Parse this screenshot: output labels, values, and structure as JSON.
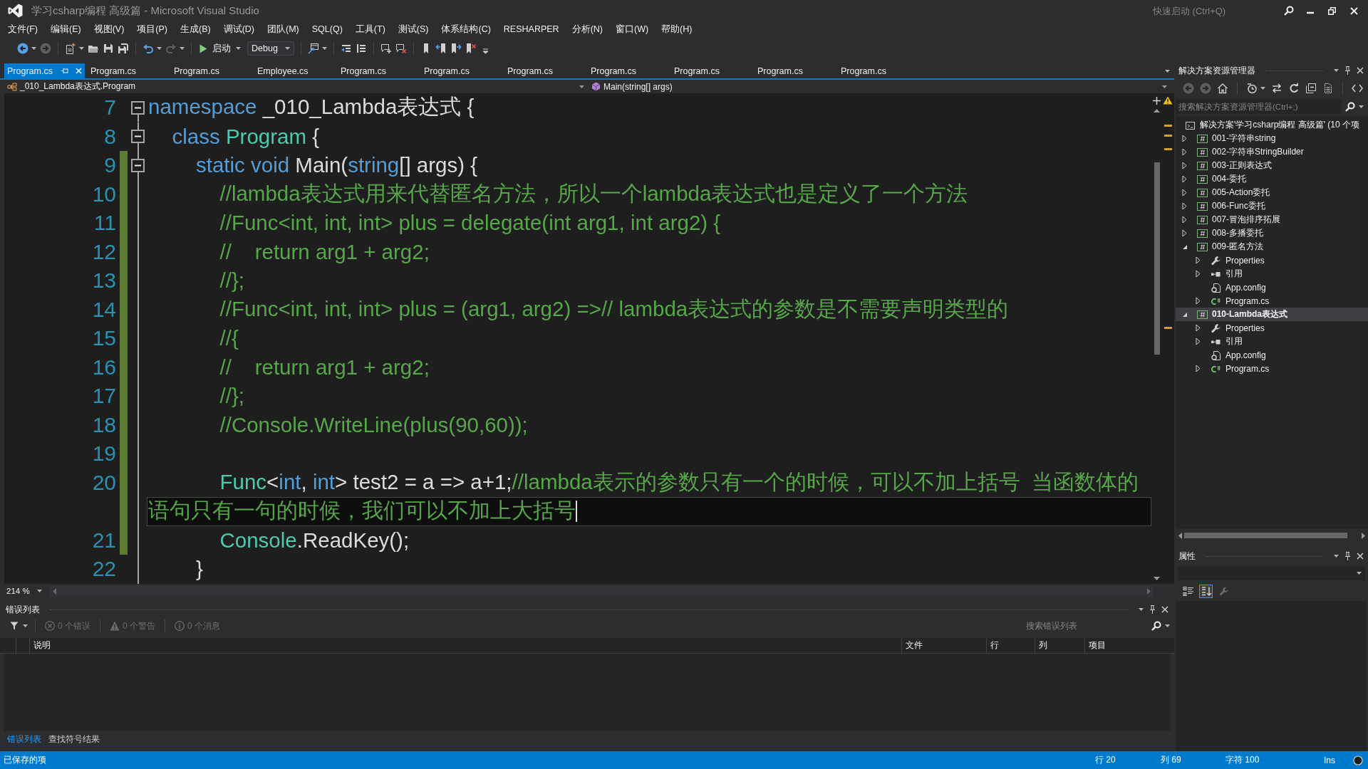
{
  "window": {
    "title": "学习csharp编程 高级篇 - Microsoft Visual Studio",
    "quick_launch": {
      "placeholder": "快速启动 (Ctrl+Q)"
    }
  },
  "menu": [
    "文件(F)",
    "编辑(E)",
    "视图(V)",
    "项目(P)",
    "生成(B)",
    "调试(D)",
    "团队(M)",
    "SQL(Q)",
    "工具(T)",
    "测试(S)",
    "体系结构(C)",
    "RESHARPER",
    "分析(N)",
    "窗口(W)",
    "帮助(H)"
  ],
  "toolbar": {
    "items": [
      {
        "kind": "back",
        "disabled": false,
        "dropdown": true
      },
      {
        "kind": "forward",
        "disabled": true
      },
      {
        "kind": "separator"
      },
      {
        "kind": "new_project",
        "disabled": false,
        "dropdown": true
      },
      {
        "kind": "open",
        "disabled": false
      },
      {
        "kind": "save",
        "disabled": false
      },
      {
        "kind": "save_all",
        "disabled": false
      },
      {
        "kind": "separator"
      },
      {
        "kind": "undo",
        "disabled": false,
        "dropdown": true
      },
      {
        "kind": "redo",
        "disabled": true,
        "dropdown": true
      },
      {
        "kind": "separator"
      },
      {
        "kind": "start",
        "label": "启动",
        "dropdown": true
      },
      {
        "kind": "configuration",
        "label": "Debug"
      },
      {
        "kind": "separator"
      },
      {
        "kind": "attach",
        "disabled": false,
        "dropdown": true
      },
      {
        "kind": "separator"
      },
      {
        "kind": "outdent",
        "disabled": false
      },
      {
        "kind": "indent",
        "disabled": false
      },
      {
        "kind": "separator"
      },
      {
        "kind": "comment",
        "disabled": false
      },
      {
        "kind": "uncomment",
        "disabled": false
      },
      {
        "kind": "separator"
      },
      {
        "kind": "bookmark",
        "disabled": false
      },
      {
        "kind": "prev_bookmark",
        "disabled": false
      },
      {
        "kind": "next_bookmark",
        "disabled": false
      },
      {
        "kind": "clear_bookmarks",
        "disabled": false
      },
      {
        "kind": "overflow",
        "disabled": false
      }
    ]
  },
  "document_tabs": [
    {
      "label": "Program.cs",
      "selected": true
    },
    {
      "label": "Program.cs",
      "selected": false
    },
    {
      "label": "Program.cs",
      "selected": false
    },
    {
      "label": "Employee.cs",
      "selected": false
    },
    {
      "label": "Program.cs",
      "selected": false
    },
    {
      "label": "Program.cs",
      "selected": false
    },
    {
      "label": "Program.cs",
      "selected": false
    },
    {
      "label": "Program.cs",
      "selected": false
    },
    {
      "label": "Program.cs",
      "selected": false
    },
    {
      "label": "Program.cs",
      "selected": false
    },
    {
      "label": "Program.cs",
      "selected": false
    }
  ],
  "navigation_bar": {
    "type": "_010_Lambda表达式.Program",
    "member": "Main(string[] args)"
  },
  "editor": {
    "zoom": "214 %",
    "lines": [
      {
        "number": "7",
        "modified": false,
        "current": false,
        "expanded": true,
        "tokens": [
          {
            "kind": "keyword",
            "text": "namespace"
          },
          {
            "kind": "plain",
            "text": " _010_Lambda表达式 {"
          }
        ],
        "children": [
          {
            "number": "8",
            "modified": false,
            "current": false,
            "expanded": true,
            "tokens": [
              {
                "kind": "keyword",
                "text": "class "
              },
              {
                "kind": "type",
                "text": "Program"
              },
              {
                "kind": "plain",
                "text": " {"
              }
            ],
            "children": [
              {
                "number": "9",
                "modified": true,
                "current": false,
                "expanded": true,
                "tokens": [
                  {
                    "kind": "keyword",
                    "text": "static void"
                  },
                  {
                    "kind": "plain",
                    "text": " Main("
                  },
                  {
                    "kind": "keyword",
                    "text": "string"
                  },
                  {
                    "kind": "plain",
                    "text": "[] args) {"
                  }
                ],
                "children": [
                  {
                    "number": "10",
                    "modified": true,
                    "current": false,
                    "tokens": [
                      {
                        "kind": "comment",
                        "text": "//lambda表达式用来代替匿名方法，所以一个lambda表达式也是定义了一个方法"
                      }
                    ]
                  },
                  {
                    "number": "11",
                    "modified": true,
                    "current": false,
                    "tokens": [
                      {
                        "kind": "comment",
                        "text": "//Func<int, int, int> plus = delegate(int arg1, int arg2) {"
                      }
                    ]
                  },
                  {
                    "number": "12",
                    "modified": true,
                    "current": false,
                    "tokens": [
                      {
                        "kind": "comment",
                        "text": "//    return arg1 + arg2;"
                      }
                    ]
                  },
                  {
                    "number": "13",
                    "modified": true,
                    "current": false,
                    "tokens": [
                      {
                        "kind": "comment",
                        "text": "//};"
                      }
                    ]
                  },
                  {
                    "number": "14",
                    "modified": true,
                    "current": false,
                    "tokens": [
                      {
                        "kind": "comment",
                        "text": "//Func<int, int, int> plus = (arg1, arg2) =>// lambda表达式的参数是不需要声明类型的"
                      }
                    ]
                  },
                  {
                    "number": "15",
                    "modified": true,
                    "current": false,
                    "tokens": [
                      {
                        "kind": "comment",
                        "text": "//{"
                      }
                    ]
                  },
                  {
                    "number": "16",
                    "modified": true,
                    "current": false,
                    "tokens": [
                      {
                        "kind": "comment",
                        "text": "//    return arg1 + arg2;"
                      }
                    ]
                  },
                  {
                    "number": "17",
                    "modified": true,
                    "current": false,
                    "tokens": [
                      {
                        "kind": "comment",
                        "text": "//};"
                      }
                    ]
                  },
                  {
                    "number": "18",
                    "modified": true,
                    "current": false,
                    "tokens": [
                      {
                        "kind": "comment",
                        "text": "//Console.WriteLine(plus(90,60));"
                      }
                    ]
                  },
                  {
                    "number": "19",
                    "modified": true,
                    "current": false
                  },
                  {
                    "number": "20",
                    "modified": true,
                    "current": true,
                    "tokens": [
                      {
                        "kind": "type",
                        "text": "Func"
                      },
                      {
                        "kind": "plain",
                        "text": "<"
                      },
                      {
                        "kind": "keyword",
                        "text": "int"
                      },
                      {
                        "kind": "plain",
                        "text": ", "
                      },
                      {
                        "kind": "keyword",
                        "text": "int"
                      },
                      {
                        "kind": "plain",
                        "text": "> test2 = a => a+1;"
                      },
                      {
                        "kind": "comment",
                        "text": "//lambda表示的参数只有一个的时候，可以不加上括号  当函数体的"
                      }
                    ],
                    "wrapped": [
                      {
                        "kind": "comment",
                        "text": "语句只有一句的时候，我们可以不加上大括号"
                      }
                    ]
                  },
                  {
                    "number": "21",
                    "modified": true,
                    "current": false,
                    "tokens": [
                      {
                        "kind": "type",
                        "text": "Console"
                      },
                      {
                        "kind": "plain",
                        "text": ".ReadKey();"
                      }
                    ]
                  }
                ]
              },
              {
                "number": "22",
                "modified": false,
                "current": false,
                "tokens": [
                  {
                    "kind": "plain",
                    "text": "}"
                  }
                ]
              }
            ]
          }
        ]
      }
    ]
  },
  "error_list": {
    "title": "错误列表",
    "filters": [
      {
        "kind": "error",
        "label": "0 个错误"
      },
      {
        "kind": "warning",
        "label": "0 个警告"
      },
      {
        "kind": "message",
        "label": "0 个消息"
      }
    ],
    "search": {
      "placeholder": "搜索错误列表"
    },
    "columns": [
      "说明",
      "文件",
      "行",
      "列",
      "项目"
    ]
  },
  "bottom_tabs": [
    {
      "label": "错误列表",
      "selected": true
    },
    {
      "label": "查找符号结果",
      "selected": false
    }
  ],
  "solution_explorer": {
    "title": "解决方案资源管理器",
    "toolbar": [
      {
        "kind": "back",
        "disabled": true
      },
      {
        "kind": "forward",
        "disabled": true
      },
      {
        "kind": "home",
        "disabled": false
      },
      {
        "kind": "separator"
      },
      {
        "kind": "history",
        "disabled": false,
        "dropdown": true
      },
      {
        "kind": "sync",
        "disabled": false
      },
      {
        "kind": "refresh",
        "disabled": false
      },
      {
        "kind": "collapse_all",
        "disabled": false
      },
      {
        "kind": "show_all",
        "disabled": false
      },
      {
        "kind": "separator"
      },
      {
        "kind": "view_code",
        "disabled": false
      }
    ],
    "search": {
      "placeholder": "搜索解决方案资源管理器(Ctrl+;)"
    },
    "tree": [
      {
        "label": "解决方案'学习csharp编程 高级篇' (10 个项",
        "kind": "solution",
        "selected": false,
        "children": [
          {
            "label": "001-字符串string",
            "kind": "project",
            "expanded": false,
            "selected": false,
            "startup": false
          },
          {
            "label": "002-字符串StringBuilder",
            "kind": "project",
            "expanded": false,
            "selected": false,
            "startup": false
          },
          {
            "label": "003-正则表达式",
            "kind": "project",
            "expanded": false,
            "selected": false,
            "startup": false
          },
          {
            "label": "004-委托",
            "kind": "project",
            "expanded": false,
            "selected": false,
            "startup": false
          },
          {
            "label": "005-Action委托",
            "kind": "project",
            "expanded": false,
            "selected": false,
            "startup": false
          },
          {
            "label": "006-Func委托",
            "kind": "project",
            "expanded": false,
            "selected": false,
            "startup": false
          },
          {
            "label": "007-冒泡排序拓展",
            "kind": "project",
            "expanded": false,
            "selected": false,
            "startup": false
          },
          {
            "label": "008-多播委托",
            "kind": "project",
            "expanded": false,
            "selected": false,
            "startup": false
          },
          {
            "label": "009-匿名方法",
            "kind": "project",
            "expanded": true,
            "selected": false,
            "startup": false,
            "children": [
              {
                "label": "Properties",
                "kind": "properties",
                "expanded": false,
                "selected": false
              },
              {
                "label": "引用",
                "kind": "references",
                "expanded": false,
                "selected": false
              },
              {
                "label": "App.config",
                "kind": "config",
                "selected": false
              },
              {
                "label": "Program.cs",
                "kind": "code_file",
                "expanded": false,
                "selected": false
              }
            ]
          },
          {
            "label": "010-Lambda表达式",
            "kind": "project",
            "expanded": true,
            "selected": true,
            "startup": true,
            "children": [
              {
                "label": "Properties",
                "kind": "properties",
                "expanded": false,
                "selected": false
              },
              {
                "label": "引用",
                "kind": "references",
                "expanded": false,
                "selected": false
              },
              {
                "label": "App.config",
                "kind": "config",
                "selected": false
              },
              {
                "label": "Program.cs",
                "kind": "code_file",
                "expanded": false,
                "selected": false
              }
            ]
          }
        ]
      }
    ]
  },
  "properties": {
    "title": "属性",
    "toolbar": [
      {
        "kind": "categorized",
        "selected": false
      },
      {
        "kind": "alphabetical",
        "selected": true
      },
      {
        "kind": "property_pages",
        "selected": false
      }
    ]
  },
  "status_bar": {
    "message": "已保存的项",
    "line": "行 20",
    "column": "列 69",
    "characters": "字符 100",
    "mode": "Ins"
  }
}
